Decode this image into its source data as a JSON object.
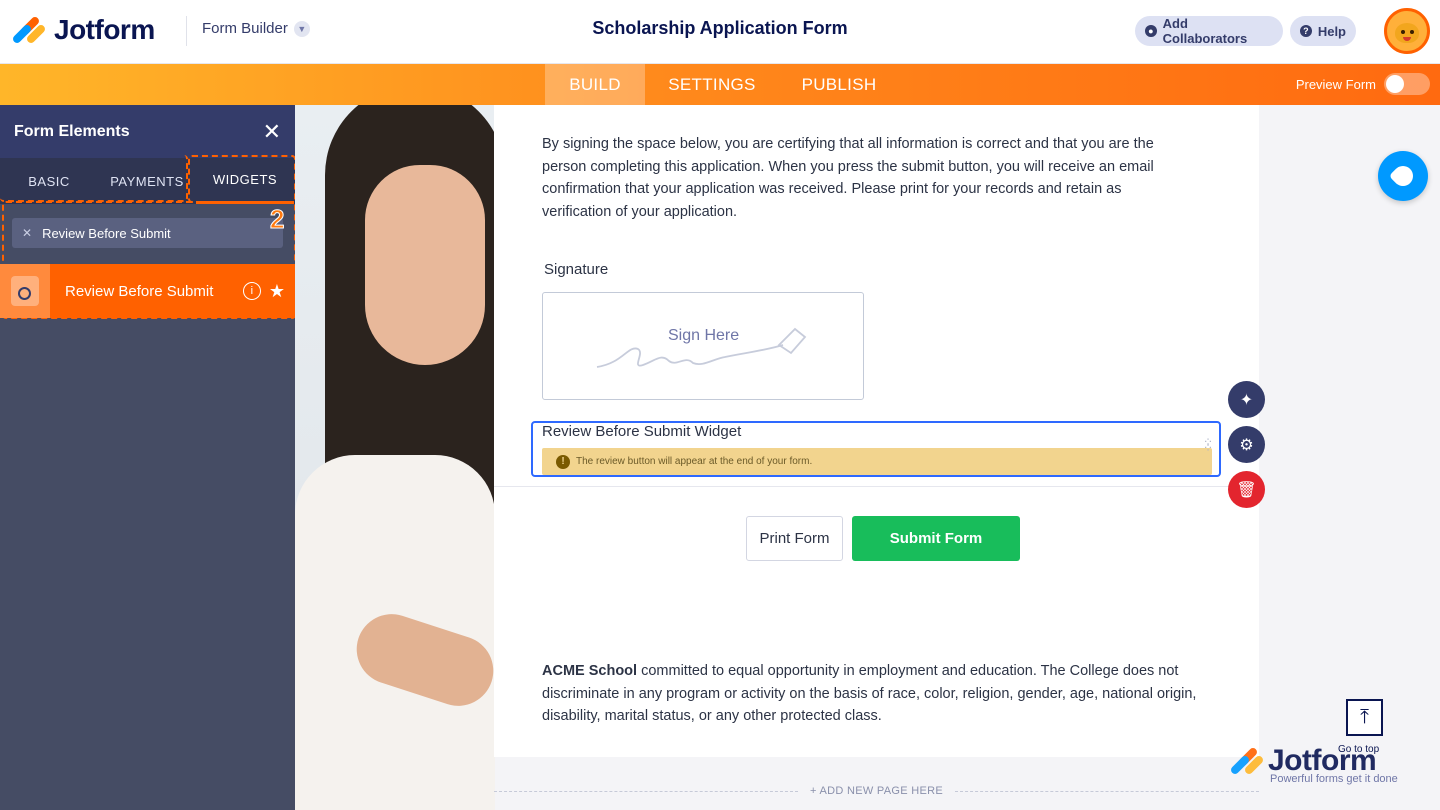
{
  "header": {
    "brand": "Jotform",
    "menu_label": "Form Builder",
    "form_title": "Scholarship Application Form",
    "add_collaborators": "Add Collaborators",
    "help": "Help"
  },
  "nav": {
    "tabs": [
      {
        "label": "BUILD",
        "active": true
      },
      {
        "label": "SETTINGS",
        "active": false
      },
      {
        "label": "PUBLISH",
        "active": false
      }
    ],
    "preview_label": "Preview Form",
    "preview_on": false
  },
  "panel": {
    "title": "Form Elements",
    "tabs": [
      {
        "label": "BASIC"
      },
      {
        "label": "PAYMENTS"
      },
      {
        "label": "WIDGETS",
        "selected": true
      }
    ],
    "search_value": "Review Before Submit",
    "step_number": "2",
    "result": {
      "label": "Review Before Submit",
      "icon": "magnifier-icon"
    }
  },
  "form": {
    "certification_text": "By signing the space below, you are certifying that all information is correct and that you are the person completing this application. When you press the submit button, you will receive an email confirmation that your application was received. Please print for your records and retain as verification of your application.",
    "signature_label": "Signature",
    "signature_placeholder": "Sign Here",
    "review_widget_title": "Review Before Submit Widget",
    "review_widget_note": "The review button will appear at the end of your form.",
    "print_button": "Print Form",
    "submit_button": "Submit Form",
    "footer_org": "ACME School",
    "footer_text": " committed to equal opportunity in employment and education. The College does not discriminate in any program or activity on the basis of race, color, religion, gender, age, national origin, disability, marital status, or any other protected class.",
    "add_page": "+ ADD NEW PAGE HERE"
  },
  "tools": {
    "wand_icon": "magic-wand-icon",
    "settings_icon": "gear-icon",
    "delete_icon": "trash-icon",
    "designer_icon": "paint-roller-icon"
  },
  "floating": {
    "go_to_top": "Go to top",
    "watermark_brand": "Jotform",
    "watermark_tagline": "Powerful forms get it done"
  },
  "colors": {
    "accent_orange": "#ff6100",
    "navy": "#0a1551",
    "submit_green": "#18bd5b",
    "selection_blue": "#2e69ff",
    "delete_red": "#e3252e"
  }
}
